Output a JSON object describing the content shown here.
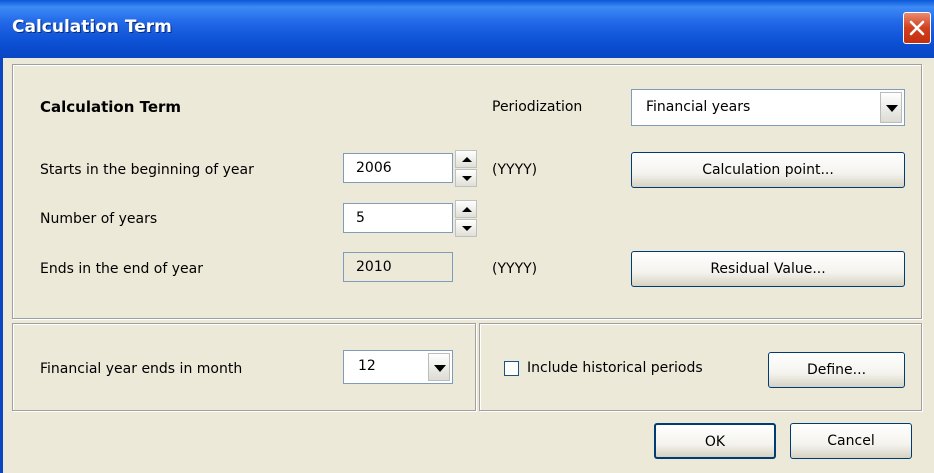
{
  "window": {
    "title": "Calculation Term"
  },
  "term": {
    "heading": "Calculation Term",
    "periodization_label": "Periodization",
    "periodization_value": "Financial years",
    "starts_label": "Starts in the beginning of year",
    "starts_value": "2006",
    "starts_hint": "(YYYY)",
    "years_label": "Number of years",
    "years_value": "5",
    "ends_label": "Ends in the end of year",
    "ends_value": "2010",
    "ends_hint": "(YYYY)",
    "calc_point_button": "Calculation point...",
    "residual_button": "Residual Value..."
  },
  "fiscal": {
    "label": "Financial year ends in month",
    "month_value": "12"
  },
  "history": {
    "checkbox_label": "Include historical periods",
    "checked": false,
    "define_button": "Define..."
  },
  "footer": {
    "ok_button": "OK",
    "cancel_button": "Cancel"
  }
}
